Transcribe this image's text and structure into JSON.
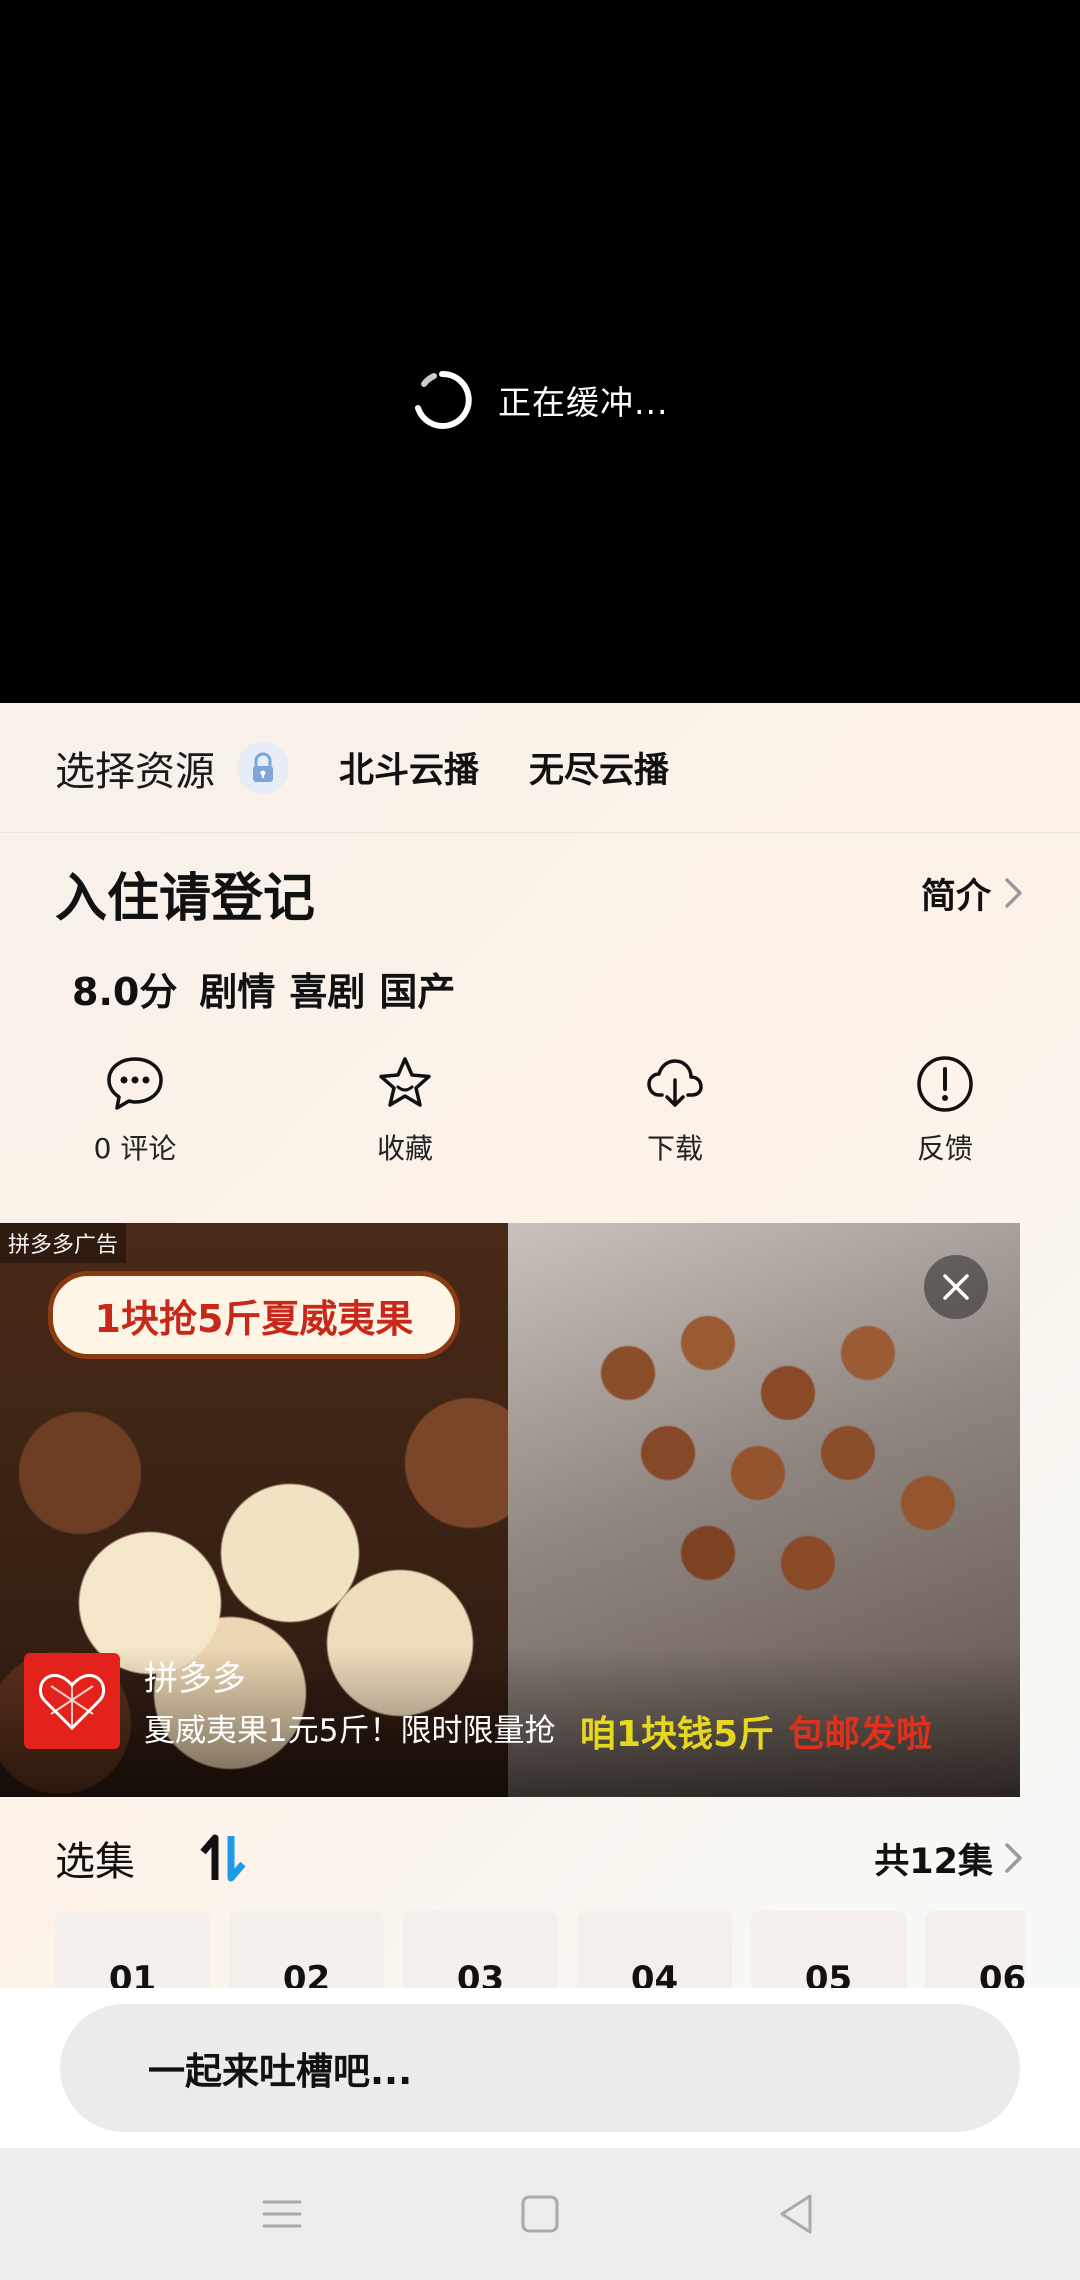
{
  "player": {
    "buffering_text": "正在缓冲..."
  },
  "source": {
    "title": "选择资源",
    "options": [
      "北斗云播",
      "无尽云播"
    ]
  },
  "show": {
    "title": "入住请登记",
    "intro_label": "简介",
    "score": "8.0分",
    "tags": [
      "剧情",
      "喜剧",
      "国产"
    ]
  },
  "actions": [
    {
      "label": "0 评论",
      "icon": "comment-icon"
    },
    {
      "label": "收藏",
      "icon": "star-icon"
    },
    {
      "label": "下载",
      "icon": "cloud-download-icon"
    },
    {
      "label": "反馈",
      "icon": "alert-icon"
    }
  ],
  "ad": {
    "tag": "拼多多广告",
    "banner": "1块抢5斤夏威夷果",
    "brand": "拼多多",
    "description": "夏威夷果1元5斤！限时限量抢",
    "overlay_yellow": "咱1块钱5斤",
    "overlay_red": "包邮发啦"
  },
  "episodes": {
    "title": "选集",
    "count_label": "共12集",
    "items": [
      "01",
      "02",
      "03",
      "04",
      "05",
      "06"
    ]
  },
  "comment": {
    "placeholder": "一起来吐槽吧..."
  },
  "colors": {
    "accent_blue": "#1e9be8",
    "ad_red": "#e3231b"
  }
}
